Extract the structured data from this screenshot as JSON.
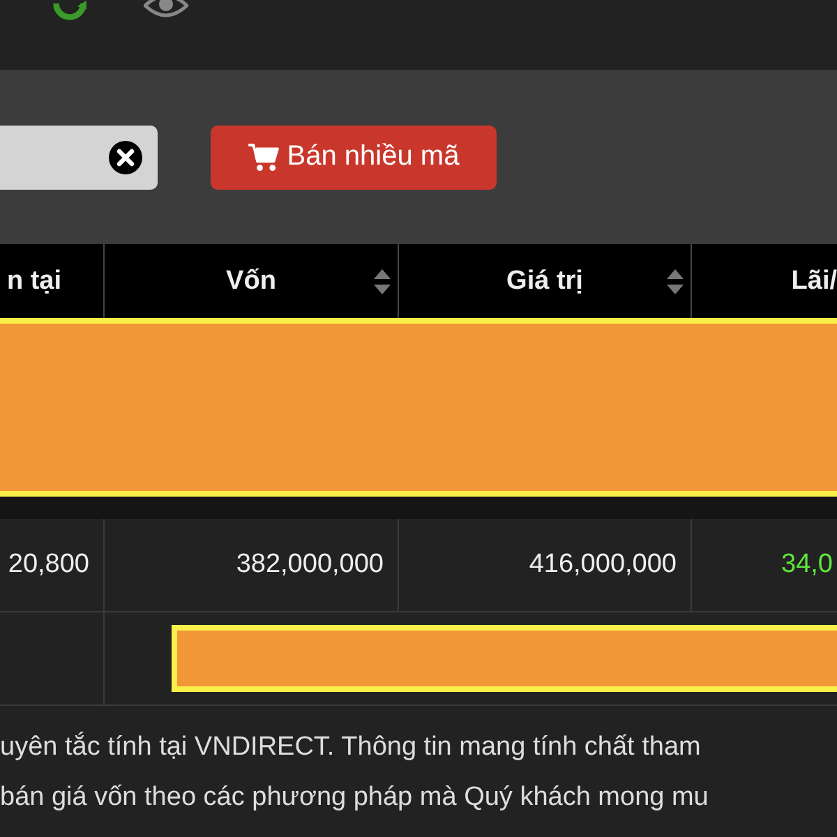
{
  "toolbar": {
    "sell_button": {
      "label": "Bán nhiều mã"
    }
  },
  "table": {
    "columns": [
      {
        "label": "n tại",
        "sortable": false
      },
      {
        "label": "Vốn",
        "sortable": true
      },
      {
        "label": "Giá trị",
        "sortable": true
      },
      {
        "label": "Lãi/",
        "sortable": false
      }
    ],
    "rows": [
      {
        "kind": "highlight"
      },
      {
        "kind": "data",
        "cells": [
          "20,800",
          "382,000,000",
          "416,000,000",
          "34,0"
        ]
      },
      {
        "kind": "partial-highlight"
      }
    ]
  },
  "note": [
    "uyên tắc tính tại VNDIRECT. Thông tin mang tính chất tham",
    "bán giá vốn theo các phương pháp mà Quý khách mong mu"
  ]
}
